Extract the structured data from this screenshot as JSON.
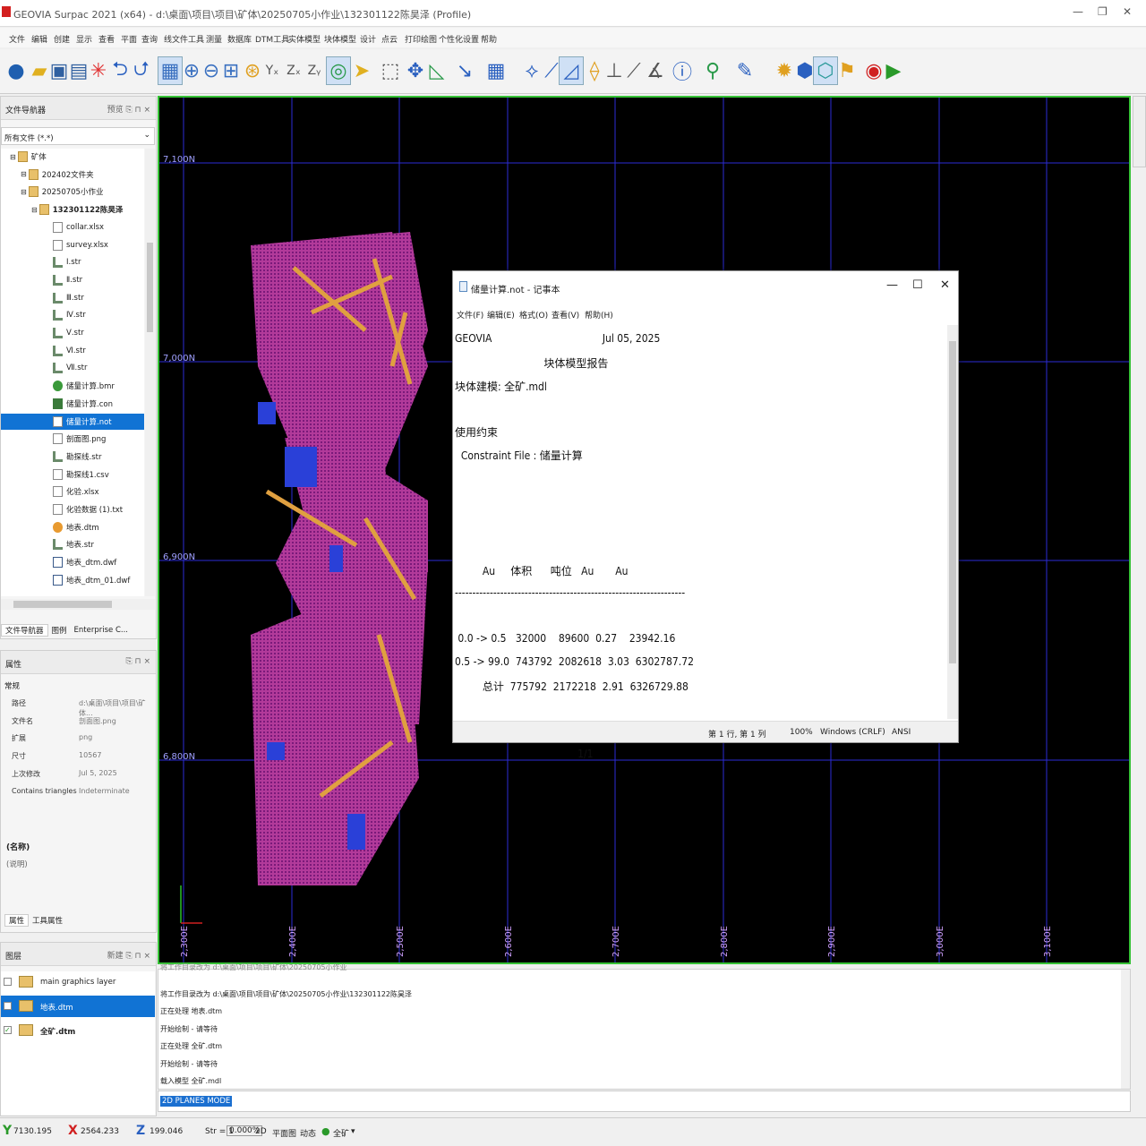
{
  "window": {
    "title": "GEOVIA Surpac 2021 (x64) - d:\\桌面\\项目\\项目\\矿体\\20250705小作业\\132301122陈昊泽 (Profile)",
    "minimize": "—",
    "restore": "❐",
    "close": "✕"
  },
  "menu": [
    "文件",
    "编辑",
    "创建",
    "显示",
    "查看",
    "平面",
    "查询",
    "线文件工具",
    "测量",
    "数据库",
    "DTM工具",
    "实体模型",
    "块体模型",
    "设计",
    "点云",
    "打印绘图",
    "个性化设置",
    "帮助"
  ],
  "file_nav": {
    "title": "文件导航器",
    "controls": "预览 ⎘ ⊓ ×",
    "filter": "所有文件 (*.*)",
    "items": [
      {
        "label": "矿体",
        "icon": "folder",
        "level": 1
      },
      {
        "label": "202402文件夹",
        "icon": "folder",
        "level": 2
      },
      {
        "label": "20250705小作业",
        "icon": "folder",
        "level": 2
      },
      {
        "label": "132301122陈昊泽",
        "icon": "folder",
        "level": 3
      },
      {
        "label": "collar.xlsx",
        "icon": "file",
        "level": 4
      },
      {
        "label": "survey.xlsx",
        "icon": "file",
        "level": 4
      },
      {
        "label": "Ⅰ.str",
        "icon": "str",
        "level": 4
      },
      {
        "label": "Ⅱ.str",
        "icon": "str",
        "level": 4
      },
      {
        "label": "Ⅲ.str",
        "icon": "str",
        "level": 4
      },
      {
        "label": "Ⅳ.str",
        "icon": "str",
        "level": 4
      },
      {
        "label": "Ⅴ.str",
        "icon": "str",
        "level": 4
      },
      {
        "label": "Ⅵ.str",
        "icon": "str",
        "level": 4
      },
      {
        "label": "Ⅶ.str",
        "icon": "str",
        "level": 4
      },
      {
        "label": "储量计算.bmr",
        "icon": "bmr",
        "level": 4
      },
      {
        "label": "储量计算.con",
        "icon": "con",
        "level": 4
      },
      {
        "label": "储量计算.not",
        "icon": "file",
        "level": 4,
        "selected": true
      },
      {
        "label": "剖面图.png",
        "icon": "file",
        "level": 4
      },
      {
        "label": "勘探线.str",
        "icon": "str",
        "level": 4
      },
      {
        "label": "勘探线1.csv",
        "icon": "file",
        "level": 4
      },
      {
        "label": "化验.xlsx",
        "icon": "file",
        "level": 4
      },
      {
        "label": "化验数据 (1).txt",
        "icon": "file",
        "level": 4
      },
      {
        "label": "地表.dtm",
        "icon": "dtm",
        "level": 4
      },
      {
        "label": "地表.str",
        "icon": "str",
        "level": 4
      },
      {
        "label": "地表_dtm.dwf",
        "icon": "dwf",
        "level": 4
      },
      {
        "label": "地表_dtm_01.dwf",
        "icon": "dwf",
        "level": 4
      }
    ],
    "tabs": [
      "文件导航器",
      "图例",
      "Enterprise C..."
    ]
  },
  "properties": {
    "title": "属性",
    "controls": "⎘ ⊓ ×",
    "section": "常规",
    "rows": [
      {
        "k": "路径",
        "v": "d:\\桌面\\项目\\项目\\矿体..."
      },
      {
        "k": "文件名",
        "v": "剖面图.png"
      },
      {
        "k": "扩展",
        "v": "png"
      },
      {
        "k": "尺寸",
        "v": "10567"
      },
      {
        "k": "上次修改",
        "v": "Jul 5, 2025"
      },
      {
        "k": "Contains triangles",
        "v": "Indeterminate"
      }
    ],
    "name_label": "(名称)",
    "desc_label": "(说明)",
    "tabs": [
      "属性",
      "工具属性"
    ]
  },
  "layers": {
    "title": "图层",
    "controls": "新建 ⎘ ⊓ ×",
    "items": [
      {
        "label": "main graphics layer",
        "selected": false,
        "checked": false
      },
      {
        "label": "地表.dtm",
        "selected": true,
        "checked": false
      },
      {
        "label": "全矿.dtm",
        "selected": false,
        "checked": true,
        "bold": true
      }
    ]
  },
  "viewport": {
    "y_labels": [
      "7,100N",
      "7,000N",
      "6,900N",
      "6,800N"
    ],
    "x_labels": [
      "2,300E",
      "2,400E",
      "2,500E",
      "2,600E",
      "2,700E",
      "2,800E",
      "2,900E",
      "3,000E",
      "3,100E"
    ],
    "colors": {
      "grid": "#2b2bd6",
      "frame": "#36c236",
      "block_magenta": "#b23a9a",
      "block_orange": "#e0a040",
      "block_blue": "#2a40d8"
    }
  },
  "notepad": {
    "title": "储量计算.not - 记事本",
    "menu": [
      "文件(F)",
      "编辑(E)",
      "格式(O)",
      "查看(V)",
      "帮助(H)"
    ],
    "lines": [
      "GEOVIA                                    Jul 05, 2025",
      "                             块体模型报告",
      "块体建模: 全矿.mdl",
      "",
      "使用约束",
      "  Constraint File : 储量计算",
      "",
      "",
      "",
      "",
      "         Au     体积      吨位   Au       Au",
      "------------------------------------------------------------------",
      "",
      " 0.0 -> 0.5   32000    89600  0.27    23942.16",
      "0.5 -> 99.0  743792  2082618  3.03  6302787.72",
      "         总计  775792  2172218  2.91  6326729.88",
      "",
      "",
      "                                        1/1"
    ],
    "status": {
      "pos": "第 1 行, 第 1 列",
      "zoom": "100%",
      "eol": "Windows (CRLF)",
      "enc": "ANSI"
    }
  },
  "log": [
    "将工作目录改为 d:\\桌面\\项目\\项目\\矿体\\20250705小作业",
    "将工作目录改为 d:\\桌面\\项目\\项目\\矿体\\20250705小作业\\132301122陈昊泽",
    "正在处理 地表.dtm",
    "开始绘制 - 请等待",
    "正在处理 全矿.dtm",
    "开始绘制 - 请等待",
    "载入模型 全矿.mdl"
  ],
  "command": "2D PLANES MODE",
  "status": {
    "y_label": "Y",
    "y": "7130.195",
    "x_label": "X",
    "x": "2564.233",
    "z_label": "Z",
    "z": "199.046",
    "str": "Str = 1",
    "pct": "0.000%",
    "mode": "2D",
    "plane": "平面图",
    "dyn": "动态",
    "layer": "全矿"
  }
}
